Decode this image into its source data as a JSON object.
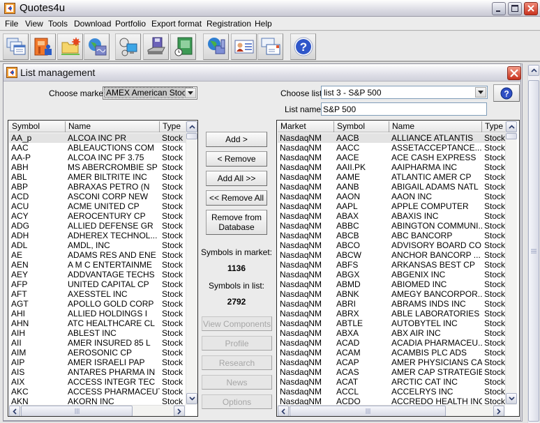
{
  "app": {
    "title": "Quotes4u",
    "window_controls": [
      "minimize",
      "maximize",
      "close"
    ]
  },
  "menu": {
    "items": [
      "File",
      "View",
      "Tools",
      "Download",
      "Portfolio",
      "Export format",
      "Registration",
      "Help"
    ]
  },
  "toolbar": {
    "icons": [
      "windows-list-icon",
      "portfolio-icon",
      "new-folder-icon",
      "globe-chart-icon",
      "network-connect-icon",
      "database-save-icon",
      "notebook-clock-icon",
      "globe-network-icon",
      "contact-card-icon",
      "mail-icon",
      "help-icon"
    ]
  },
  "dialog": {
    "title": "List management",
    "choose_market_label": "Choose market:",
    "market_value": "AMEX American Stock",
    "choose_list_label": "Choose list:",
    "list_value": "list 3 - S&P 500",
    "list_name_label": "List name:",
    "list_name_value": "S&P 500",
    "buttons": {
      "add": "Add >",
      "remove": "< Remove",
      "add_all": "Add All >>",
      "remove_all": "<< Remove All",
      "remove_from_db": "Remove from Database",
      "view_components": "View Components",
      "profile": "Profile",
      "research": "Research",
      "news": "News",
      "options": "Options"
    },
    "symbols_in_market_label": "Symbols in market:",
    "symbols_in_market": "1136",
    "symbols_in_list_label": "Symbols in list:",
    "symbols_in_list": "2792",
    "market_list": {
      "columns": [
        "Symbol",
        "Name",
        "Type"
      ],
      "selected_index": 0,
      "rows": [
        [
          "AA_p",
          "ALCOA INC PR",
          "Stock"
        ],
        [
          "AAC",
          "ABLEAUCTIONS COM",
          "Stock"
        ],
        [
          "AA-P",
          "ALCOA INC PF 3.75",
          "Stock"
        ],
        [
          "ABH",
          "MS ABERCROMBIE SP",
          "Stock"
        ],
        [
          "ABL",
          "AMER BILTRITE INC",
          "Stock"
        ],
        [
          "ABP",
          "ABRAXAS PETRO  (N",
          "Stock"
        ],
        [
          "ACD",
          "ASCONI CORP NEW",
          "Stock"
        ],
        [
          "ACU",
          "ACME UNITED CP",
          "Stock"
        ],
        [
          "ACY",
          "AEROCENTURY CP",
          "Stock"
        ],
        [
          "ADG",
          "ALLIED DEFENSE GR",
          "Stock"
        ],
        [
          "ADH",
          "ADHEREX TECHNOL...",
          "Stock"
        ],
        [
          "ADL",
          "AMDL, INC",
          "Stock"
        ],
        [
          "AE",
          "ADAMS RES AND ENE",
          "Stock"
        ],
        [
          "AEN",
          "A M C ENTERTAINME",
          "Stock"
        ],
        [
          "AEY",
          "ADDVANTAGE TECHS",
          "Stock"
        ],
        [
          "AFP",
          "UNITED CAPITAL CP",
          "Stock"
        ],
        [
          "AFT",
          "AXESSTEL INC",
          "Stock"
        ],
        [
          "AGT",
          "APOLLO GOLD CORP",
          "Stock"
        ],
        [
          "AHI",
          "ALLIED HOLDINGS I",
          "Stock"
        ],
        [
          "AHN",
          "ATC HEALTHCARE CL",
          "Stock"
        ],
        [
          "AIH",
          "ABLEST INC",
          "Stock"
        ],
        [
          "AII",
          "AMER INSURED 85 L",
          "Stock"
        ],
        [
          "AIM",
          "AEROSONIC CP",
          "Stock"
        ],
        [
          "AIP",
          "AMER ISRAELI PAP",
          "Stock"
        ],
        [
          "AIS",
          "ANTARES PHARMA IN",
          "Stock"
        ],
        [
          "AIX",
          "ACCESS INTEGR TEC",
          "Stock"
        ],
        [
          "AKC",
          "ACCESS PHARMACEUT",
          "Stock"
        ],
        [
          "AKN",
          "AKORN INC",
          "Stock"
        ]
      ]
    },
    "selected_list": {
      "columns": [
        "Market",
        "Symbol",
        "Name",
        "Type"
      ],
      "selected_index": 0,
      "rows": [
        [
          "NasdaqNM",
          "AACB",
          "ALLIANCE ATLANTIS",
          "Stock"
        ],
        [
          "NasdaqNM",
          "AACC",
          "ASSETACCEPTANCE...",
          "Stock"
        ],
        [
          "NasdaqNM",
          "AACE",
          "ACE CASH EXPRESS",
          "Stock"
        ],
        [
          "NasdaqNM",
          "AAII.PK",
          "AAIPHARMA INC",
          "Stock"
        ],
        [
          "NasdaqNM",
          "AAME",
          "ATLANTIC AMER CP",
          "Stock"
        ],
        [
          "NasdaqNM",
          "AANB",
          "ABIGAIL ADAMS NATL",
          "Stock"
        ],
        [
          "NasdaqNM",
          "AAON",
          "AAON INC",
          "Stock"
        ],
        [
          "NasdaqNM",
          "AAPL",
          "APPLE COMPUTER",
          "Stock"
        ],
        [
          "NasdaqNM",
          "ABAX",
          "ABAXIS INC",
          "Stock"
        ],
        [
          "NasdaqNM",
          "ABBC",
          "ABINGTON COMMUNI...",
          "Stock"
        ],
        [
          "NasdaqNM",
          "ABCB",
          "ABC BANCORP",
          "Stock"
        ],
        [
          "NasdaqNM",
          "ABCO",
          "ADVISORY BOARD CO",
          "Stock"
        ],
        [
          "NasdaqNM",
          "ABCW",
          "ANCHOR BANCORP ...",
          "Stock"
        ],
        [
          "NasdaqNM",
          "ABFS",
          "ARKANSAS BEST CP",
          "Stock"
        ],
        [
          "NasdaqNM",
          "ABGX",
          "ABGENIX INC",
          "Stock"
        ],
        [
          "NasdaqNM",
          "ABMD",
          "ABIOMED INC",
          "Stock"
        ],
        [
          "NasdaqNM",
          "ABNK",
          "AMEGY BANCORPOR...",
          "Stock"
        ],
        [
          "NasdaqNM",
          "ABRI",
          "ABRAMS INDS INC",
          "Stock"
        ],
        [
          "NasdaqNM",
          "ABRX",
          "ABLE LABORATORIES",
          "Stock"
        ],
        [
          "NasdaqNM",
          "ABTLE",
          "AUTOBYTEL INC",
          "Stock"
        ],
        [
          "NasdaqNM",
          "ABXA",
          "ABX AIR INC",
          "Stock"
        ],
        [
          "NasdaqNM",
          "ACAD",
          "ACADIA PHARMACEU...",
          "Stock"
        ],
        [
          "NasdaqNM",
          "ACAM",
          "ACAMBIS PLC ADS",
          "Stock"
        ],
        [
          "NasdaqNM",
          "ACAP",
          "AMER PHYSICIANS CA",
          "Stock"
        ],
        [
          "NasdaqNM",
          "ACAS",
          "AMER CAP STRATEGIE",
          "Stock"
        ],
        [
          "NasdaqNM",
          "ACAT",
          "ARCTIC CAT INC",
          "Stock"
        ],
        [
          "NasdaqNM",
          "ACCL",
          "ACCELRYS INC",
          "Stock"
        ],
        [
          "NasdaqNM",
          "ACDO",
          "ACCREDO HEALTH INC",
          "Stock"
        ]
      ]
    }
  }
}
